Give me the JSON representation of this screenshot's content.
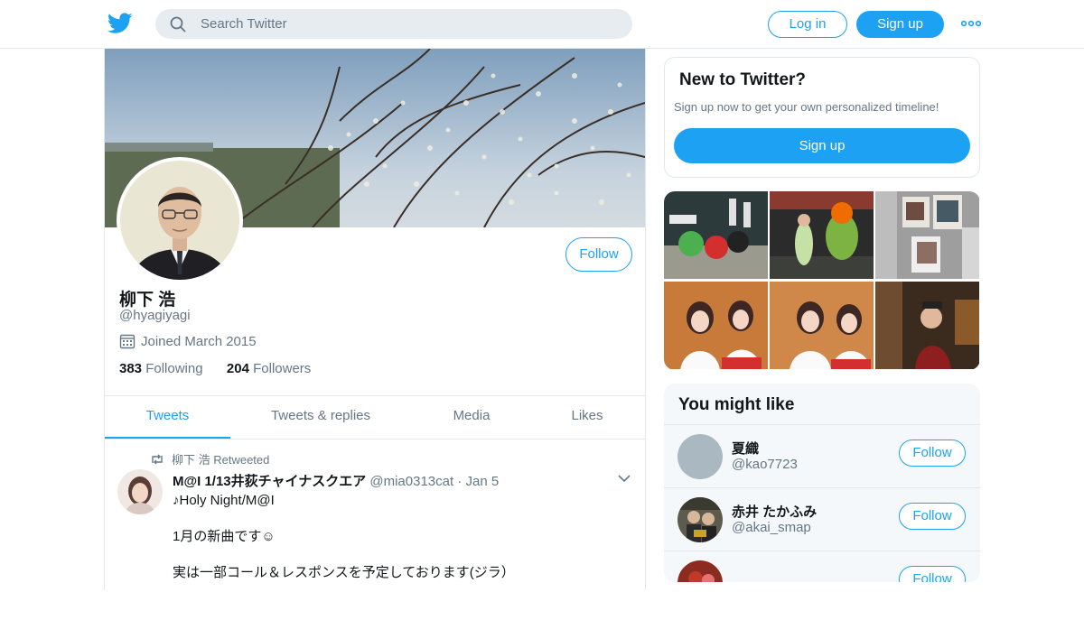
{
  "header": {
    "search_placeholder": "Search Twitter",
    "login_label": "Log in",
    "signup_label": "Sign up"
  },
  "profile": {
    "name": "柳下 浩",
    "handle": "@hyagiyagi",
    "joined": "Joined March 2015",
    "following_count": "383",
    "following_label": "Following",
    "followers_count": "204",
    "followers_label": "Followers",
    "follow_label": "Follow"
  },
  "tabs": [
    {
      "label": "Tweets",
      "active": true
    },
    {
      "label": "Tweets & replies",
      "active": false
    },
    {
      "label": "Media",
      "active": false
    },
    {
      "label": "Likes",
      "active": false
    }
  ],
  "tweet": {
    "retweet_line": "柳下 浩 Retweeted",
    "author_name": "M@I 1/13井荻チャイナスクエア",
    "author_handle": "@mia0313cat",
    "separator": "·",
    "date": "Jan 5",
    "body_line1": "♪Holy Night/M@I",
    "body_line2": "1月の新曲です☺",
    "body_line3": "実は一部コール＆レスポンスを予定しております(ジラ）"
  },
  "new_to_twitter": {
    "title": "New to Twitter?",
    "subtitle": "Sign up now to get your own personalized timeline!",
    "signup_label": "Sign up"
  },
  "you_might_like": {
    "title": "You might like",
    "items": [
      {
        "name": "夏織",
        "handle": "@kao7723",
        "follow_label": "Follow"
      },
      {
        "name": "赤井 たかふみ",
        "handle": "@akai_smap",
        "follow_label": "Follow"
      },
      {
        "name": "",
        "handle": "",
        "follow_label": "Follow"
      }
    ]
  },
  "colors": {
    "accent": "#1da1f2",
    "text_primary": "#14171a",
    "text_secondary": "#657786",
    "border": "#e1e8ed"
  }
}
